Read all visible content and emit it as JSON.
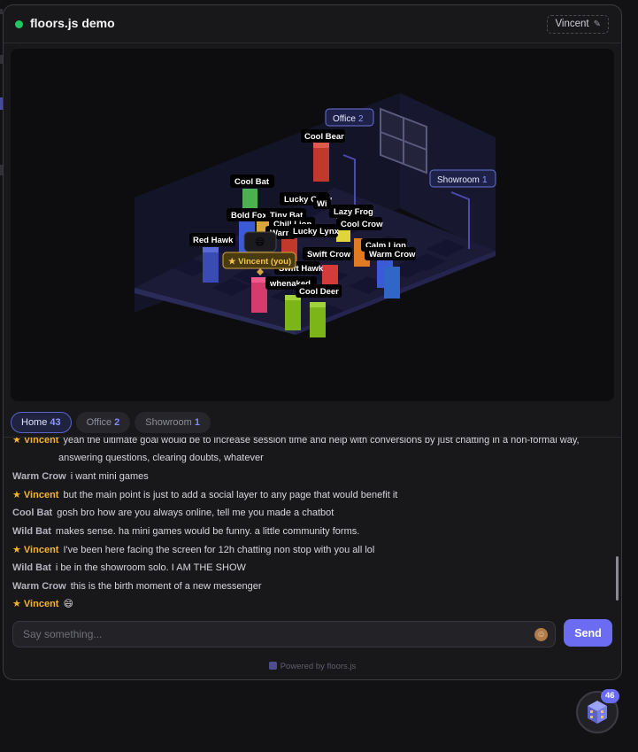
{
  "app": {
    "title": "floors.js demo",
    "user_name": "Vincent",
    "status_color": "#22c55e"
  },
  "icons": {
    "edit": "pencil-icon",
    "emoji": "emoji-icon",
    "powered_logo": "floors-logo-icon",
    "fab": "building-icon"
  },
  "scene": {
    "room_labels": [
      {
        "name": "Office",
        "count": "2"
      },
      {
        "name": "Showroom",
        "count": "1"
      }
    ],
    "avatars": [
      "Cool Bear",
      "Cool Bat",
      "Lucky Crow",
      "Bold Fox",
      "Tiny Bat",
      "Lazy Frog",
      "Chill Lion",
      "Cool Crow",
      "Warm",
      "Lucky Lynx",
      "Red Hawk",
      "Calm Lion",
      "Swift Crow",
      "Warm Crow",
      "★ Vincent (you)",
      "Swift Hawk",
      "whenaked",
      "Cool Deer",
      "Wi"
    ],
    "bubble_emoji": "😄"
  },
  "tabs": [
    {
      "label": "Home",
      "count": "43",
      "active": true
    },
    {
      "label": "Office",
      "count": "2",
      "active": false
    },
    {
      "label": "Showroom",
      "count": "1",
      "active": false
    }
  ],
  "messages": [
    {
      "author": "★ Vincent",
      "me": true,
      "text": "yeah the ultimate goal would be to increase session time and help with conversions by just chatting in a non-formal way,",
      "cont": "answering questions, clearing doubts, whatever"
    },
    {
      "author": "Warm Crow",
      "me": false,
      "text": "i want mini games"
    },
    {
      "author": "★ Vincent",
      "me": true,
      "text": "but the main point is just to add a social layer to any page that would benefit it"
    },
    {
      "author": "Cool Bat",
      "me": false,
      "text": "gosh bro how are you always online, tell me you made a chatbot"
    },
    {
      "author": "Wild Bat",
      "me": false,
      "text": "makes sense. ha mini games would be funny. a little community forms."
    },
    {
      "author": "★ Vincent",
      "me": true,
      "text": "I've been here facing the screen for 12h chatting non stop with you all lol"
    },
    {
      "author": "Wild Bat",
      "me": false,
      "text": "i be in the showroom solo. I AM THE SHOW"
    },
    {
      "author": "Warm Crow",
      "me": false,
      "text": "this is the birth moment of a new messenger"
    },
    {
      "author": "★ Vincent",
      "me": true,
      "text": "😄"
    }
  ],
  "composer": {
    "placeholder": "Say something...",
    "send_label": "Send"
  },
  "footer": {
    "powered_prefix": "Powered by ",
    "powered_name": "floors.js"
  },
  "fab": {
    "badge": "46"
  }
}
